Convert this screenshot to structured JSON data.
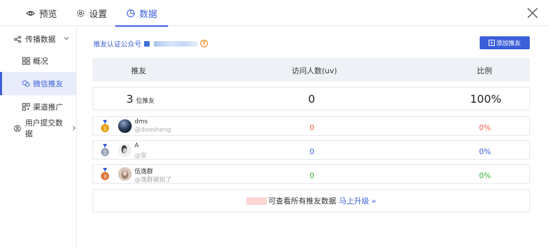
{
  "tabs": [
    {
      "label": "预览",
      "icon": "eye-icon"
    },
    {
      "label": "设置",
      "icon": "gear-icon"
    },
    {
      "label": "数据",
      "icon": "pie-chart-icon",
      "active": true
    }
  ],
  "sidebar": {
    "group1": {
      "label": "传播数据",
      "icon": "share-icon",
      "caret": "chevron-down-icon"
    },
    "items": [
      {
        "label": "概况",
        "icon": "grid-icon"
      },
      {
        "label": "微信推友",
        "icon": "wechat-icon",
        "active": true
      },
      {
        "label": "渠道推广",
        "icon": "qrcode-icon"
      }
    ],
    "group2": {
      "label": "用户提交数据",
      "icon": "user-icon",
      "caret": "chevron-right-icon"
    }
  },
  "main": {
    "account_label": "推友认证公众号",
    "add_button": "添加推友",
    "columns": [
      "推友",
      "访问人数(uv)",
      "比例"
    ],
    "summary": {
      "count": "3",
      "unit": "位推友",
      "uv": "0",
      "ratio": "100%"
    },
    "rows": [
      {
        "rank": 1,
        "name": "dms",
        "handle": "@doosheng",
        "uv": "0",
        "ratio": "0%",
        "color": "#f05a4a",
        "medal": "#e8a21a"
      },
      {
        "rank": 2,
        "name": "A",
        "handle": "@安",
        "uv": "0",
        "ratio": "0%",
        "color": "#3b5fd9",
        "medal": "#9aa7b8"
      },
      {
        "rank": 3,
        "name": "伍逸群",
        "handle": "@逸群被拍了",
        "uv": "0",
        "ratio": "0%",
        "color": "#34b233",
        "medal": "#d9783a"
      }
    ],
    "footer": {
      "text": "可查看所有推友数据",
      "link": "马上升级 »"
    }
  }
}
